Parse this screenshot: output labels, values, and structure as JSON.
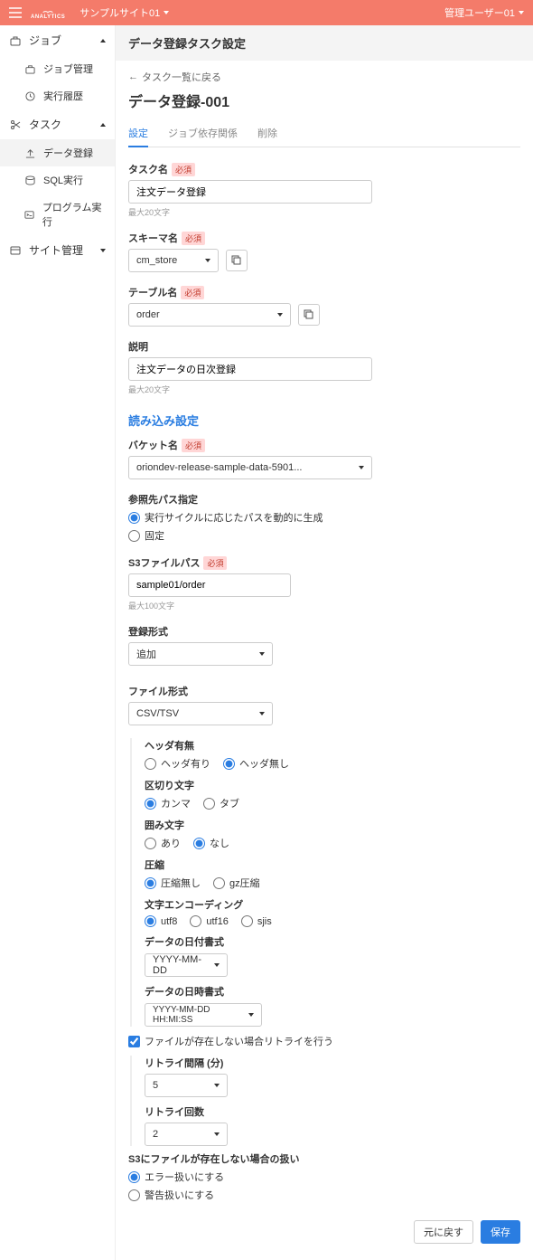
{
  "header": {
    "site": "サンプルサイト01",
    "user": "管理ユーザー01",
    "logo_text": "ANALYTICS"
  },
  "sidebar": {
    "groups": [
      {
        "label": "ジョブ",
        "open": true,
        "items": [
          {
            "label": "ジョブ管理"
          },
          {
            "label": "実行履歴"
          }
        ]
      },
      {
        "label": "タスク",
        "open": true,
        "items": [
          {
            "label": "データ登録",
            "active": true
          },
          {
            "label": "SQL実行"
          },
          {
            "label": "プログラム実行"
          }
        ]
      },
      {
        "label": "サイト管理",
        "open": false,
        "items": []
      }
    ]
  },
  "page": {
    "header": "データ登録タスク設定",
    "back": "タスク一覧に戻る",
    "title": "データ登録-001"
  },
  "tabs": [
    {
      "label": "設定",
      "active": true
    },
    {
      "label": "ジョブ依存関係"
    },
    {
      "label": "削除"
    }
  ],
  "labels": {
    "required": "必須",
    "task_name": "タスク名",
    "task_name_hint": "最大20文字",
    "schema_name": "スキーマ名",
    "table_name": "テーブル名",
    "description": "説明",
    "desc_hint": "最大20文字",
    "read_settings": "読み込み設定",
    "bucket_name": "バケット名",
    "ref_path": "参照先パス指定",
    "ref_dynamic": "実行サイクルに応じたパスを動的に生成",
    "ref_fixed": "固定",
    "s3_path": "S3ファイルパス",
    "s3_hint": "最大100文字",
    "reg_type": "登録形式",
    "file_format": "ファイル形式",
    "header": "ヘッダ有無",
    "header_yes": "ヘッダ有り",
    "header_no": "ヘッダ無し",
    "delimiter": "区切り文字",
    "delim_comma": "カンマ",
    "delim_tab": "タブ",
    "enclose": "囲み文字",
    "enc_yes": "あり",
    "enc_no": "なし",
    "compress": "圧縮",
    "comp_none": "圧縮無し",
    "comp_gz": "gz圧縮",
    "encoding": "文字エンコーディング",
    "enc_utf8": "utf8",
    "enc_utf16": "utf16",
    "enc_sjis": "sjis",
    "date_fmt": "データの日付書式",
    "datetime_fmt": "データの日時書式",
    "retry_check": "ファイルが存在しない場合リトライを行う",
    "retry_interval": "リトライ間隔 (分)",
    "retry_count": "リトライ回数",
    "s3_missing": "S3にファイルが存在しない場合の扱い",
    "miss_error": "エラー扱いにする",
    "miss_warn": "警告扱いにする",
    "btn_reset": "元に戻す",
    "btn_save": "保存"
  },
  "values": {
    "task_name": "注文データ登録",
    "schema": "cm_store",
    "table": "order",
    "description": "注文データの日次登録",
    "bucket": "oriondev-release-sample-data-5901...",
    "ref_path": "dynamic",
    "s3_path": "sample01/order",
    "reg_type": "追加",
    "file_format": "CSV/TSV",
    "header": "no",
    "delimiter": "comma",
    "enclose": "no",
    "compress": "none",
    "encoding": "utf8",
    "date_fmt": "YYYY-MM-DD",
    "datetime_fmt": "YYYY-MM-DD HH:MI:SS",
    "retry_on": true,
    "retry_interval": "5",
    "retry_count": "2",
    "s3_missing": "error"
  }
}
